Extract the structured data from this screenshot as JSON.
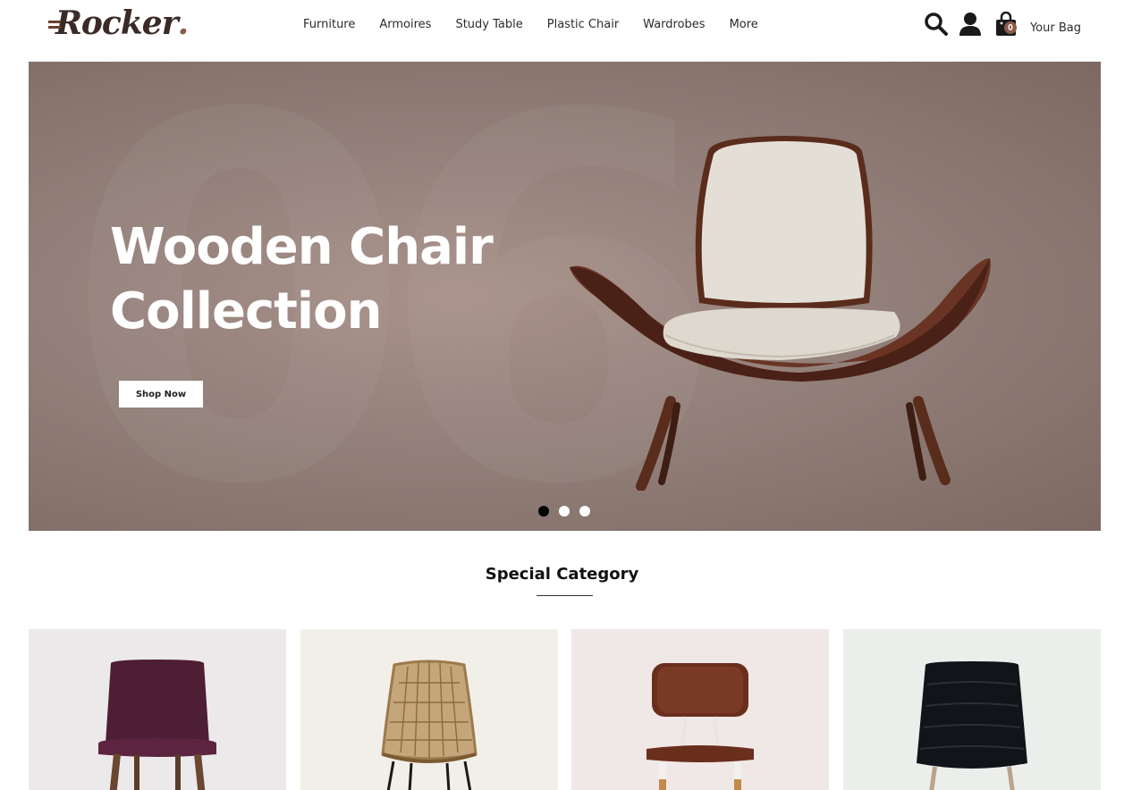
{
  "brand": {
    "logo_text": "Rocker",
    "logo_dot": ".",
    "accent": "#8a5b4a"
  },
  "nav": {
    "items": [
      "Furniture",
      "Armoires",
      "Study Table",
      "Plastic Chair",
      "Wardrobes",
      "More"
    ]
  },
  "actions": {
    "search_icon": "search-icon",
    "user_icon": "user-icon",
    "bag_icon": "shopping-bag-icon",
    "bag_count": "0",
    "bag_label": "Your Bag"
  },
  "hero": {
    "title_line1": "Wooden Chair",
    "title_line2": "Collection",
    "button_label": "Shop Now",
    "background_color": "#93807a",
    "slides": 3,
    "active_slide": 1
  },
  "section": {
    "title": "Special Category"
  },
  "categories": [
    {
      "image": "plum upholstered chair",
      "bg": "#ece9ea"
    },
    {
      "image": "rattan wire chair",
      "bg": "#f2efe9"
    },
    {
      "image": "brown leather seat chair",
      "bg": "#f0e8e6"
    },
    {
      "image": "black tufted chair",
      "bg": "#eceeec"
    }
  ]
}
